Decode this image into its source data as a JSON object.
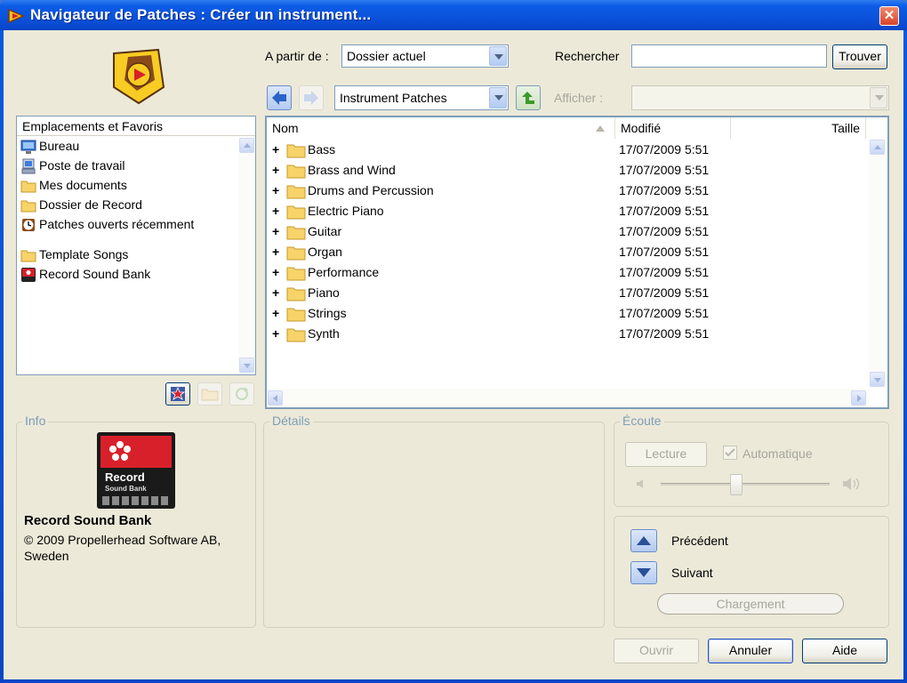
{
  "window": {
    "title": "Navigateur de Patches : Créer un instrument...",
    "close_glyph": "✕"
  },
  "toolbar": {
    "from_label": "A partir de :",
    "from_value": "Dossier actuel",
    "search_label": "Rechercher",
    "search_value": "",
    "find_button": "Trouver",
    "location_value": "Instrument Patches",
    "show_label": "Afficher :",
    "show_value": ""
  },
  "locations": {
    "header": "Emplacements et Favoris",
    "items": [
      {
        "label": "Bureau",
        "icon": "desktop-icon"
      },
      {
        "label": "Poste de travail",
        "icon": "computer-icon"
      },
      {
        "label": "Mes documents",
        "icon": "folder-icon"
      },
      {
        "label": "Dossier de Record",
        "icon": "folder-icon"
      },
      {
        "label": "Patches ouverts récemment",
        "icon": "clock-icon"
      }
    ],
    "favorites": [
      {
        "label": "Template Songs",
        "icon": "folder-icon"
      },
      {
        "label": "Record Sound Bank",
        "icon": "record-bank-icon"
      }
    ]
  },
  "files": {
    "columns": {
      "name": "Nom",
      "modified": "Modifié",
      "size": "Taille"
    },
    "rows": [
      {
        "name": "Bass",
        "modified": "17/07/2009 5:51"
      },
      {
        "name": "Brass and Wind",
        "modified": "17/07/2009 5:51"
      },
      {
        "name": "Drums and Percussion",
        "modified": "17/07/2009 5:51"
      },
      {
        "name": "Electric Piano",
        "modified": "17/07/2009 5:51"
      },
      {
        "name": "Guitar",
        "modified": "17/07/2009 5:51"
      },
      {
        "name": "Organ",
        "modified": "17/07/2009 5:51"
      },
      {
        "name": "Performance",
        "modified": "17/07/2009 5:51"
      },
      {
        "name": "Piano",
        "modified": "17/07/2009 5:51"
      },
      {
        "name": "Strings",
        "modified": "17/07/2009 5:51"
      },
      {
        "name": "Synth",
        "modified": "17/07/2009 5:51"
      }
    ],
    "expand_glyph": "+"
  },
  "info": {
    "title": "Info",
    "badge_word": "Record",
    "badge_sub": "Sound Bank",
    "name": "Record Sound Bank",
    "copyright_line1": "© 2009 Propellerhead Software AB,",
    "copyright_line2": "Sweden"
  },
  "details": {
    "title": "Détails"
  },
  "listen": {
    "title": "Écoute",
    "play_button": "Lecture",
    "auto_label": "Automatique",
    "auto_checked": true
  },
  "navigation": {
    "previous_label": "Précédent",
    "next_label": "Suivant",
    "loading_label": "Chargement"
  },
  "footer": {
    "open_button": "Ouvrir",
    "cancel_button": "Annuler",
    "help_button": "Aide"
  }
}
